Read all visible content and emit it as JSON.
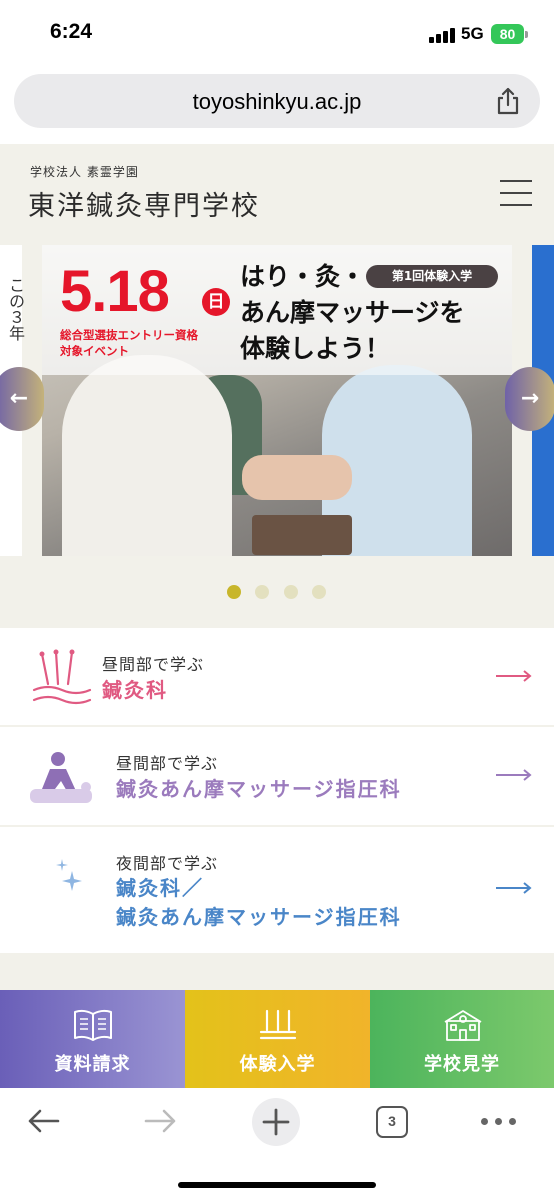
{
  "status_bar": {
    "time": "6:24",
    "network": "5G",
    "battery": "80"
  },
  "browser": {
    "url": "toyoshinkyu.ac.jp",
    "tab_count": "3"
  },
  "header": {
    "subtitle": "学校法人 素霊学園",
    "school_name": "東洋鍼灸専門学校"
  },
  "carousel": {
    "left_peek_text": "この３年",
    "date": "5.18",
    "day": "日",
    "event_line1": "総合型選抜エントリー資格",
    "event_line2": "対象イベント",
    "badge": "第1回体験入学",
    "headline_line1": "はり・灸・",
    "headline_line2": "あん摩マッサージを",
    "headline_line3": "体験しよう！",
    "prev_label": "←",
    "next_label": "→",
    "active_index": 0,
    "slide_count": 4
  },
  "courses": [
    {
      "sub": "昼間部で学ぶ",
      "title": "鍼灸科",
      "title2": "",
      "color": "#e05a82",
      "icon": "acupuncture-needles-icon"
    },
    {
      "sub": "昼間部で学ぶ",
      "title": "鍼灸あん摩マッサージ指圧科",
      "title2": "",
      "color": "#9b7bbd",
      "icon": "massage-icon"
    },
    {
      "sub": "夜間部で学ぶ",
      "title": "鍼灸科／",
      "title2": "鍼灸あん摩マッサージ指圧科",
      "color": "#4a86c8",
      "icon": "moon-stars-icon"
    }
  ],
  "cta": [
    {
      "label": "資料請求",
      "icon": "book-icon"
    },
    {
      "label": "体験入学",
      "icon": "needles-icon"
    },
    {
      "label": "学校見学",
      "icon": "school-building-icon"
    }
  ]
}
